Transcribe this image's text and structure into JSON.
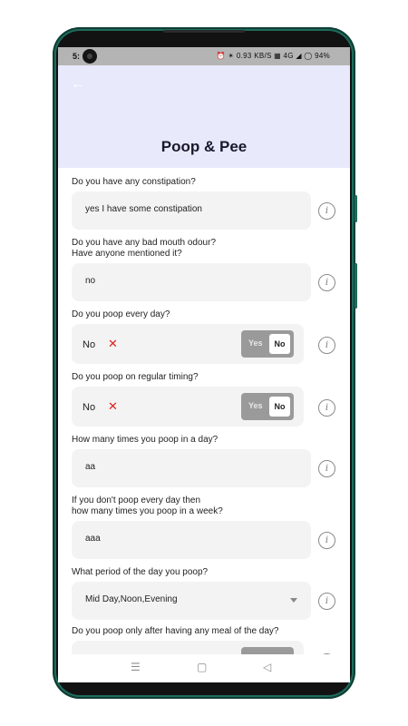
{
  "status_bar": {
    "time": "5:",
    "indicators": "⏰ ✴ 0.93 KB/S ▦ 4G ◢ ◯ 94%"
  },
  "header": {
    "back_icon": "arrow-left-icon",
    "title": "Poop & Pee"
  },
  "form": {
    "q1": {
      "question": "Do you have any constipation?",
      "value": "yes I have some constipation"
    },
    "q2": {
      "question_line1": "Do you have any bad mouth odour?",
      "question_line2": "Have anyone mentioned it?",
      "value": "no"
    },
    "q3": {
      "question": "Do you poop every day?",
      "value": "No",
      "toggle_yes": "Yes",
      "toggle_no": "No"
    },
    "q4": {
      "question": "Do you poop on regular timing?",
      "value": "No",
      "toggle_yes": "Yes",
      "toggle_no": "No"
    },
    "q5": {
      "question": "How many times you poop in a day?",
      "value": "aa"
    },
    "q6": {
      "question_line1": "If you don't poop every day then",
      "question_line2": "how many times you poop in a week?",
      "value": "aaa"
    },
    "q7": {
      "question": "What period of the day you poop?",
      "value": "Mid Day,Noon,Evening"
    },
    "q8": {
      "question": "Do you poop only after having any meal of the day?"
    }
  },
  "info_icon": "i",
  "nav": {
    "menu": "☰",
    "home": "▢",
    "back": "◁"
  }
}
